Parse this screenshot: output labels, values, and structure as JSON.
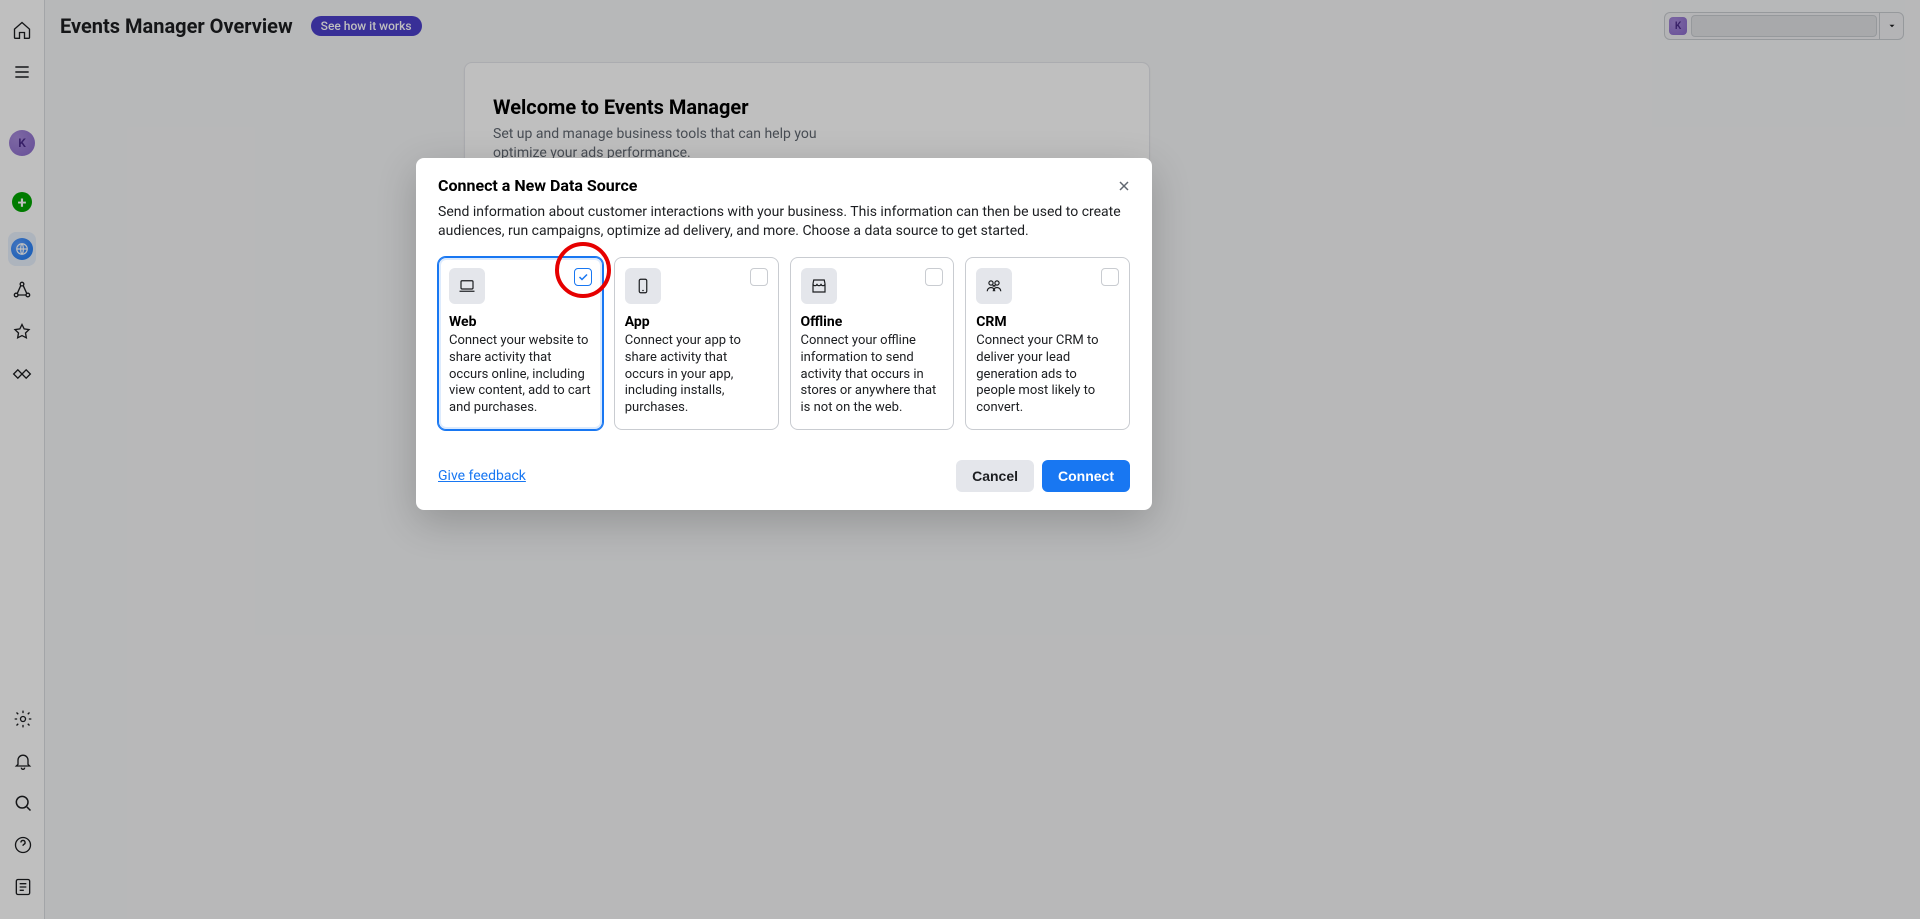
{
  "header": {
    "title": "Events Manager Overview",
    "see_how": "See how it works",
    "account_avatar_letter": "K"
  },
  "sidebar": {
    "avatar_letter": "K"
  },
  "welcome": {
    "title": "Welcome to Events Manager",
    "subtitle": "Set up and manage business tools that can help you optimize your ads performance."
  },
  "modal": {
    "title": "Connect a New Data Source",
    "subtext": "Send information about customer interactions with your business. This information can then be used to create audiences, run campaigns, optimize ad delivery, and more. Choose a data source to get started.",
    "feedback": "Give feedback",
    "cancel_label": "Cancel",
    "connect_label": "Connect",
    "options": [
      {
        "key": "web",
        "title": "Web",
        "desc": "Connect your website to share activity that occurs online, including view content, add to cart and purchases.",
        "selected": true,
        "icon": "laptop"
      },
      {
        "key": "app",
        "title": "App",
        "desc": "Connect your app to share activity that occurs in your app, including installs, purchases.",
        "selected": false,
        "icon": "mobile"
      },
      {
        "key": "offline",
        "title": "Offline",
        "desc": "Connect your offline information to send activity that occurs in stores or anywhere that is not on the web.",
        "selected": false,
        "icon": "store"
      },
      {
        "key": "crm",
        "title": "CRM",
        "desc": "Connect your CRM to deliver your lead generation ads to people most likely to convert.",
        "selected": false,
        "icon": "crm"
      }
    ]
  }
}
